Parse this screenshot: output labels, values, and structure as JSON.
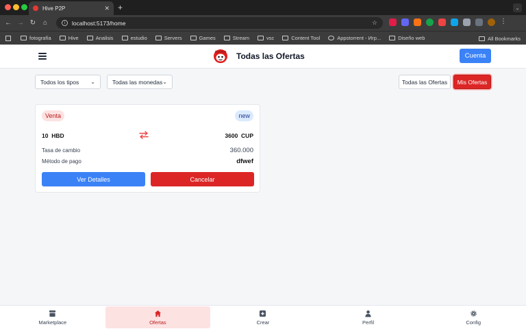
{
  "browser": {
    "tab_title": "Hive P2P",
    "url": "localhost:5173/home",
    "bookmarks": [
      "fotografía",
      "Hive",
      "Analisis",
      "estudio",
      "Servers",
      "Games",
      "Stream",
      "vsc",
      "Content Tool",
      "Appstorrent - Игр...",
      "Diseño web"
    ],
    "all_bookmarks": "All Bookmarks"
  },
  "header": {
    "title": "Todas las Ofertas",
    "account_button": "Cuenta"
  },
  "filters": {
    "type_select": "Todos los tipos",
    "currency_select": "Todas las monedas",
    "all_offers_button": "Todas las Ofertas",
    "my_offers_button": "Mis Ofertas"
  },
  "offer": {
    "kind_badge": "Venta",
    "status_badge": "new",
    "give_amount": "10",
    "give_currency": "HBD",
    "get_amount": "3600",
    "get_currency": "CUP",
    "rate_label": "Tasa de cambio",
    "rate_value": "360.000",
    "payment_label": "Método de pago",
    "payment_value": "dfwef",
    "details_button": "Ver Detalles",
    "cancel_button": "Cancelar"
  },
  "bottom_nav": {
    "items": [
      {
        "label": "Marketplace",
        "icon": "store-icon"
      },
      {
        "label": "Ofertas",
        "icon": "home-icon"
      },
      {
        "label": "Crear",
        "icon": "plus-square-icon"
      },
      {
        "label": "Perfil",
        "icon": "user-icon"
      },
      {
        "label": "Config",
        "icon": "gear-icon"
      }
    ]
  },
  "colors": {
    "primary": "#3b82f6",
    "danger": "#dc2626",
    "active_bg": "#fde2e2"
  }
}
